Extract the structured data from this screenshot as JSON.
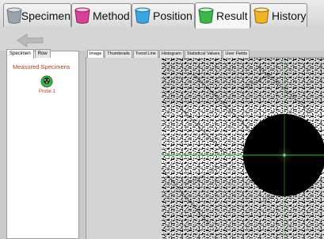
{
  "main_tabs": [
    {
      "label": "Specimen",
      "icon": "cup-gray-icon",
      "color": "#9aa4b0"
    },
    {
      "label": "Method",
      "icon": "cup-pink-icon",
      "color": "#d9409c"
    },
    {
      "label": "Position",
      "icon": "cup-blue-icon",
      "color": "#3aa7e0"
    },
    {
      "label": "Result",
      "icon": "cup-green-icon",
      "color": "#3cb54a"
    },
    {
      "label": "History",
      "icon": "cup-yellow-icon",
      "color": "#f0b323"
    }
  ],
  "active_main_tab": "Result",
  "left_tabs": [
    {
      "label": "Specimen"
    },
    {
      "label": "Row"
    }
  ],
  "measured_specimens_heading": "Measured Specimens",
  "probe": {
    "label": "Probe 1",
    "color": "#3cb54a"
  },
  "right_tabs": [
    {
      "label": "Image"
    },
    {
      "label": "Thumbnails"
    },
    {
      "label": "Trend Line"
    },
    {
      "label": "Histogram"
    },
    {
      "label": "Statistical Values"
    },
    {
      "label": "User Fields"
    }
  ],
  "colors": {
    "accent_text": "#c4351e",
    "crosshair": "#2ec52e"
  }
}
